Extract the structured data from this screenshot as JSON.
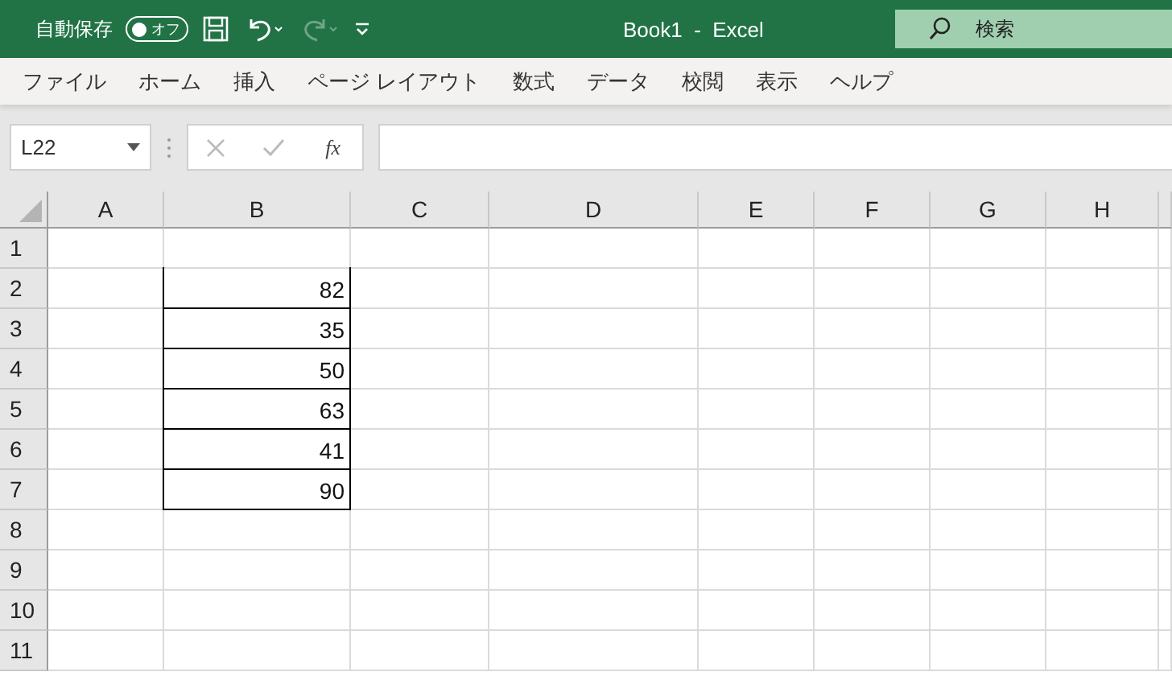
{
  "title_bar": {
    "autosave_label": "自動保存",
    "autosave": {
      "label": "オフ",
      "on": false
    },
    "redo_disabled": true,
    "title": "Book1  -  Excel",
    "search": {
      "placeholder": "検索"
    }
  },
  "ribbon_tabs": [
    {
      "label": "ファイル",
      "selected": false
    },
    {
      "label": "ホーム",
      "selected": false
    },
    {
      "label": "挿入",
      "selected": false
    },
    {
      "label": "ページ レイアウト",
      "selected": false
    },
    {
      "label": "数式",
      "selected": false
    },
    {
      "label": "データ",
      "selected": false
    },
    {
      "label": "校閲",
      "selected": false
    },
    {
      "label": "表示",
      "selected": false
    },
    {
      "label": "ヘルプ",
      "selected": false
    }
  ],
  "formula_bar": {
    "name_box": "L22",
    "function_label": "fx"
  },
  "sheet": {
    "columns": [
      "A",
      "B",
      "C",
      "D",
      "E",
      "F",
      "G",
      "H"
    ],
    "rows": [
      {
        "header": "1",
        "bordered": false
      },
      {
        "header": "2",
        "column_b": "82",
        "bordered": true
      },
      {
        "header": "3",
        "column_b": "35",
        "bordered": true
      },
      {
        "header": "4",
        "column_b": "50",
        "bordered": true
      },
      {
        "header": "5",
        "column_b": "63",
        "bordered": true
      },
      {
        "header": "6",
        "column_b": "41",
        "bordered": true
      },
      {
        "header": "7",
        "column_b": "90",
        "bordered": true
      },
      {
        "header": "8",
        "bordered": false
      },
      {
        "header": "9",
        "bordered": false
      },
      {
        "header": "10",
        "bordered": false
      },
      {
        "header": "11",
        "bordered": false
      }
    ]
  }
}
